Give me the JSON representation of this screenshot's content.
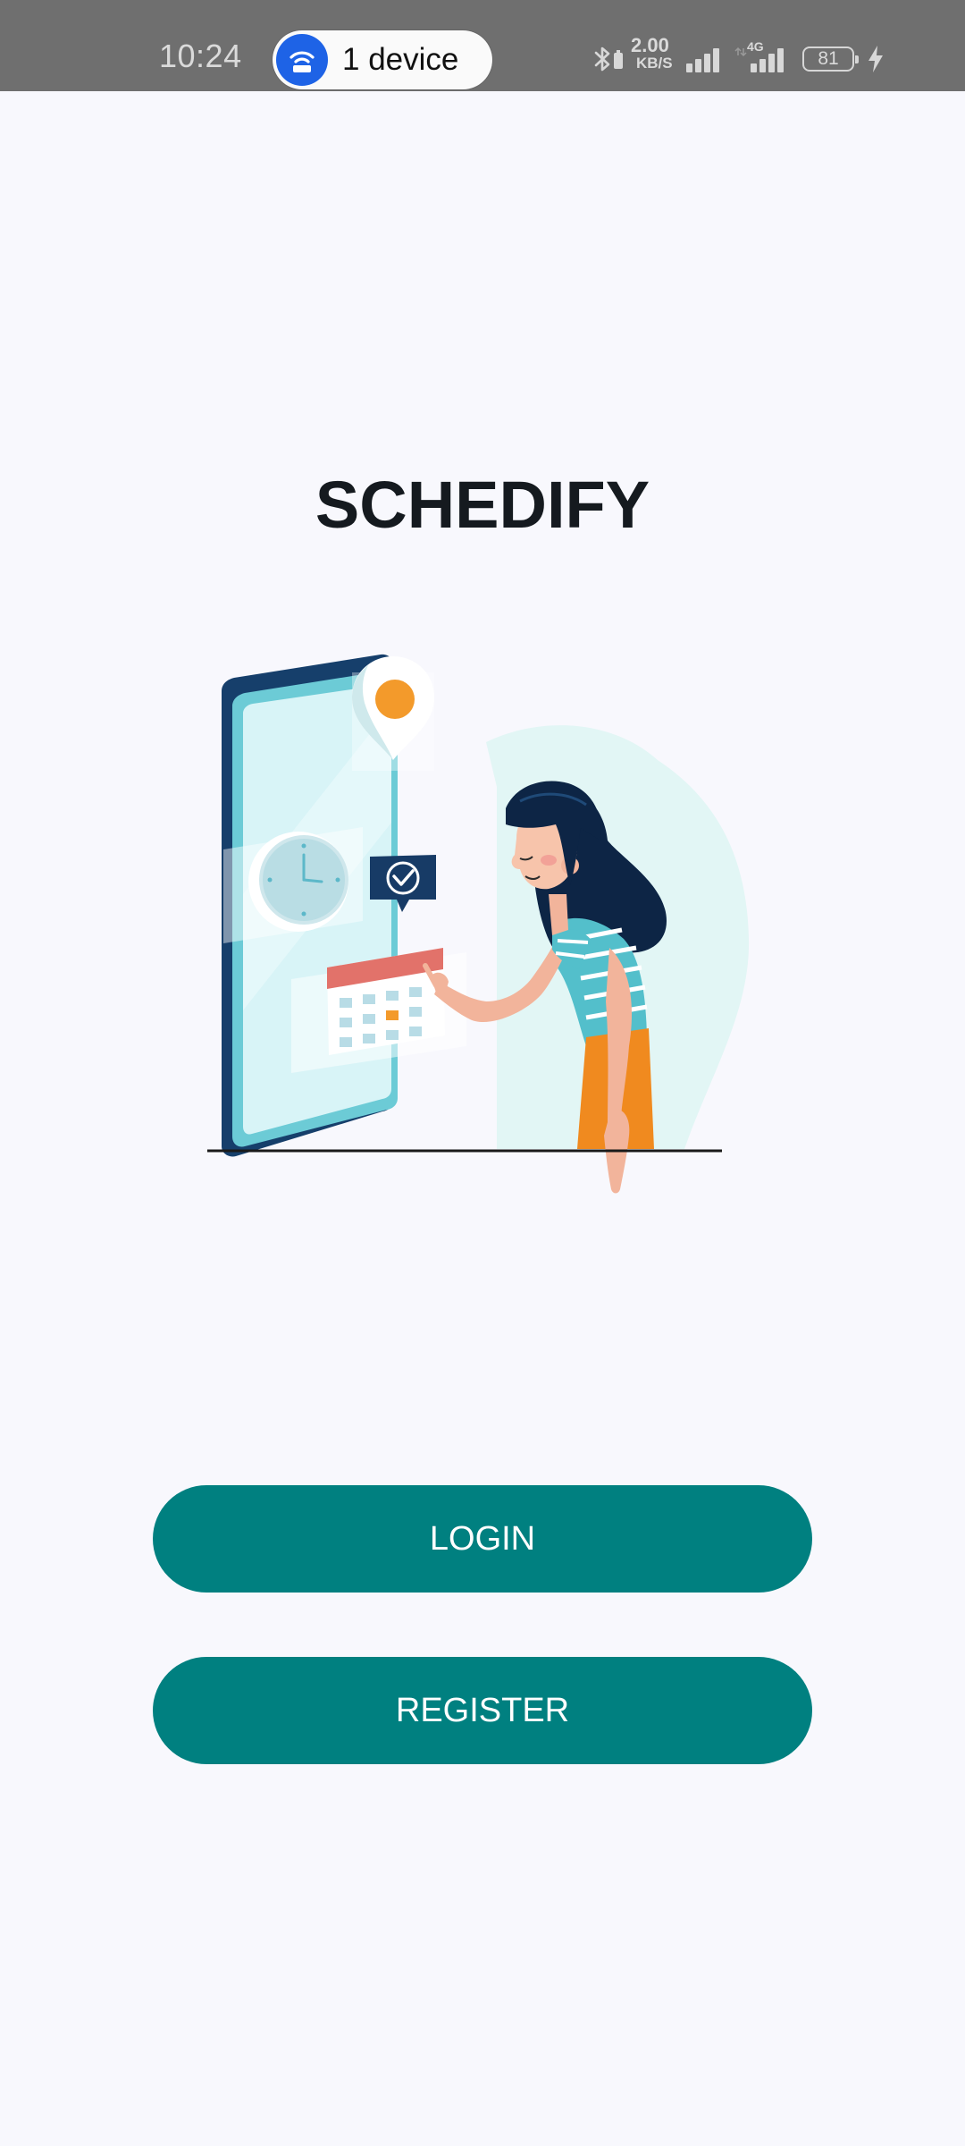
{
  "status_bar": {
    "time": "10:24",
    "hotspot_label": "1 device",
    "speed_value": "2.00",
    "speed_unit": "KB/S",
    "network_type": "4G",
    "battery_level": "81",
    "icons": [
      "hotspot-icon",
      "bluetooth-icon",
      "signal-icon",
      "signal-4g-icon",
      "battery-icon",
      "charging-icon"
    ]
  },
  "app": {
    "title": "SCHEDIFY"
  },
  "illustration": {
    "name": "woman-scheduling-on-phone-illustration"
  },
  "actions": {
    "login_label": "LOGIN",
    "register_label": "REGISTER"
  },
  "colors": {
    "background": "#F8F8FD",
    "status_bar": "#6F6F6F",
    "button": "#008080",
    "button_text": "#FFFFFF",
    "title": "#151A1F",
    "hotspot_accent": "#1E63E6"
  }
}
